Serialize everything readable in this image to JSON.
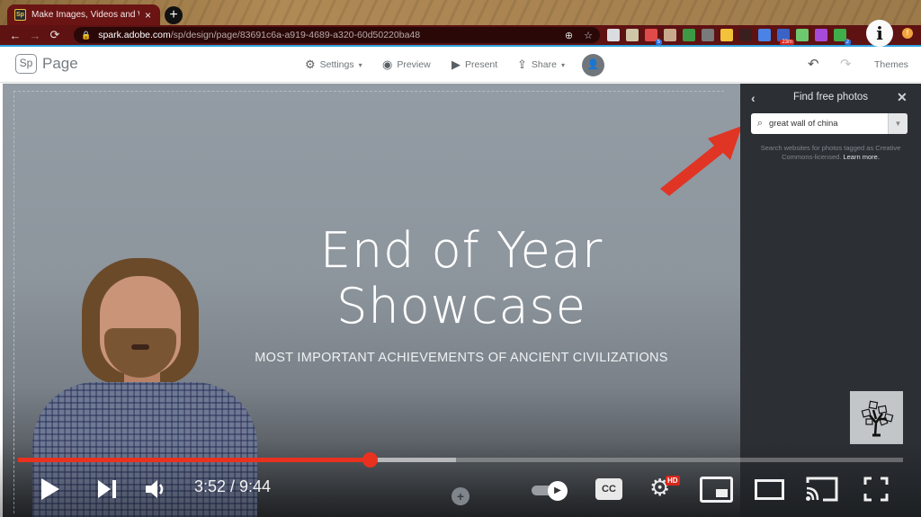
{
  "browser": {
    "tab": {
      "favicon": "Sp",
      "title": "Make Images, Videos and Web Stories",
      "close_icon": "×"
    },
    "new_tab_icon": "+",
    "nav": {
      "back": "←",
      "forward": "→",
      "reload": "C"
    },
    "url": {
      "host": "spark.adobe.com",
      "path": "/sp/design/page/83691c6a-a919-4689-a320-60d50220ba48"
    },
    "omnibox_icons": {
      "zoom": "⊕",
      "star": "☆"
    },
    "extensions": [
      {
        "name": "ext-1",
        "color": "#d9dde0"
      },
      {
        "name": "ext-2",
        "color": "#d0c6a8"
      },
      {
        "name": "ext-3",
        "color": "#e04a4a",
        "badge": "5"
      },
      {
        "name": "ext-4",
        "color": "#c9a98b"
      },
      {
        "name": "google-classroom",
        "color": "#3c9a45"
      },
      {
        "name": "ext-6",
        "color": "#7a7a7a"
      },
      {
        "name": "google-drive",
        "color": "#f3c13a"
      },
      {
        "name": "ext-8",
        "color": "#3a1f1f"
      },
      {
        "name": "google-translate",
        "color": "#4a83e6"
      },
      {
        "name": "ext-10",
        "color": "#3b63c7",
        "badge": "23m"
      },
      {
        "name": "ext-11",
        "color": "#6ec86e"
      },
      {
        "name": "ext-12",
        "color": "#a64ad9"
      },
      {
        "name": "ext-13",
        "color": "#3fae4a",
        "badge": "2"
      }
    ],
    "info_button": "i",
    "alert_badge": "!"
  },
  "spark": {
    "logo": "Sp",
    "app_name": "Page",
    "toolbar": {
      "settings": "Settings",
      "preview": "Preview",
      "present": "Present",
      "share": "Share",
      "themes": "Themes"
    }
  },
  "canvas": {
    "title_line1": "End of Year",
    "title_line2": "Showcase",
    "subtitle": "MOST IMPORTANT ACHIEVEMENTS OF ANCIENT CIVILIZATIONS"
  },
  "panel": {
    "title": "Find free photos",
    "search_value": "great wall of china",
    "help_text": "Search websites for photos tagged as Creative Commons-licensed.",
    "learn_more": "Learn more."
  },
  "player": {
    "current_time": "3:52",
    "duration": "9:44",
    "time_display": "3:52 / 9:44",
    "played_fraction": 0.397,
    "buffered_fraction": 0.495,
    "cc_label": "CC",
    "quality_badge": "HD",
    "colors": {
      "progress": "#e8311f",
      "annotation_arrow": "#e03424"
    }
  }
}
